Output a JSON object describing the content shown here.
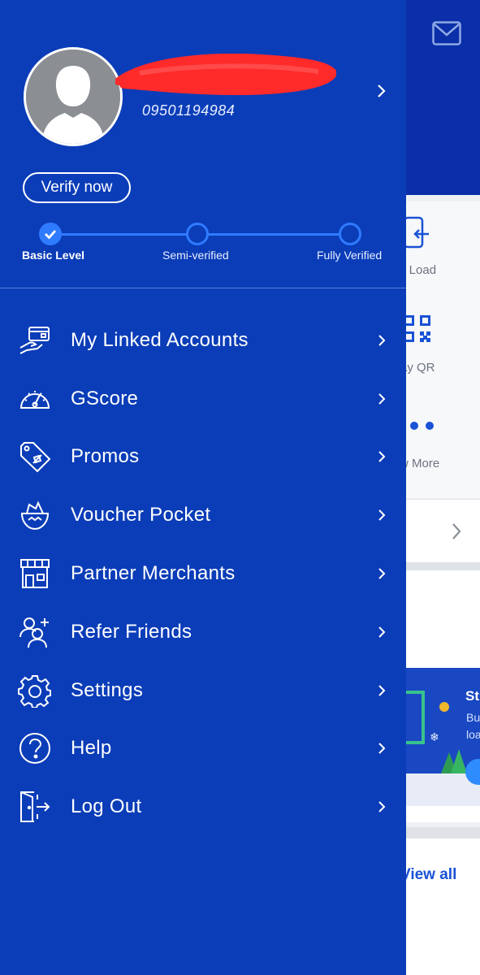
{
  "colors": {
    "drawer_bg": "#0b3db8",
    "accent": "#2f7bff",
    "background_header": "#0a2fa8"
  },
  "profile": {
    "phone": "09501194984",
    "avatar_icon": "person-silhouette-icon",
    "verify_label": "Verify now"
  },
  "verification": {
    "levels": [
      {
        "label": "Basic Level",
        "state": "completed"
      },
      {
        "label": "Semi-verified",
        "state": "pending"
      },
      {
        "label": "Fully Verified",
        "state": "pending"
      }
    ]
  },
  "menu": [
    {
      "label": "My Linked Accounts",
      "icon": "linked-accounts-icon"
    },
    {
      "label": "GScore",
      "icon": "speedometer-icon"
    },
    {
      "label": "Promos",
      "icon": "promo-tag-icon"
    },
    {
      "label": "Voucher Pocket",
      "icon": "voucher-pocket-icon"
    },
    {
      "label": "Partner Merchants",
      "icon": "storefront-icon"
    },
    {
      "label": "Refer Friends",
      "icon": "add-friend-icon"
    },
    {
      "label": "Settings",
      "icon": "gear-icon"
    },
    {
      "label": "Help",
      "icon": "help-icon"
    },
    {
      "label": "Log Out",
      "icon": "logout-icon"
    }
  ],
  "background": {
    "buy_load_label": "y Load",
    "pay_qr_label": "ay QR",
    "view_more_label": "w More",
    "banner_title": "St",
    "banner_line1": "Bu",
    "banner_line2": "loa",
    "view_all_label": "View all"
  }
}
